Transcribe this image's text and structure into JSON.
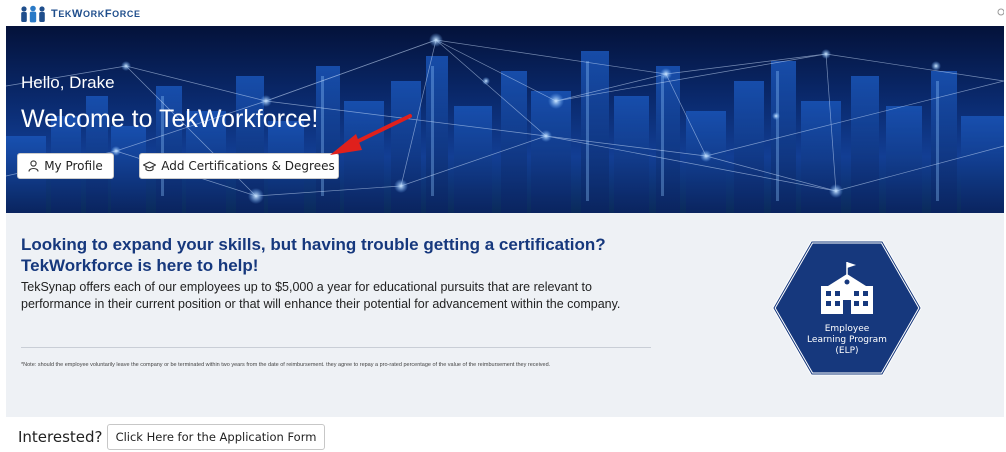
{
  "brand": {
    "logo_text_1": "T",
    "logo_text_2": "EK",
    "logo_text_3": "W",
    "logo_text_4": "ORK",
    "logo_text_5": "F",
    "logo_text_6": "ORCE"
  },
  "hero": {
    "greeting": "Hello, Drake",
    "welcome": "Welcome to TekWorkforce!",
    "profile_button": "My Profile",
    "cert_button": "Add Certifications & Degrees"
  },
  "info": {
    "headline": "Looking to expand your skills, but having trouble getting a certification? TekWorkforce is here to help!",
    "description": "TekSynap offers each of our employees up to $5,000 a year for educational pursuits that are relevant to performance in their current position or that will enhance their potential for advancement within the company.",
    "note": "*Note: should the employee voluntarily leave the company or be terminated within two years from the date of reimbursement. they agree to repay a pro-rated percentage of the value of the reimbursement they received.",
    "badge_line1": "Employee",
    "badge_line2": "Learning Program",
    "badge_line3": "(ELP)"
  },
  "footer": {
    "interested_label": "Interested?",
    "application_button": "Click Here for the Application Form"
  },
  "colors": {
    "hero_dark": "#04123a",
    "headline": "#16387d",
    "badge": "#16387d",
    "arrow": "#e0201c",
    "panel_bg": "#eef1f5"
  },
  "icons": {
    "profile": "user-icon",
    "cert": "graduation-cap-icon",
    "badge": "school-icon"
  }
}
